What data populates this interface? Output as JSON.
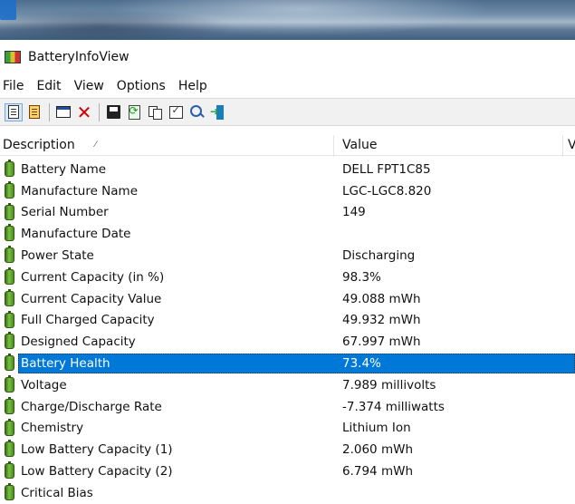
{
  "window": {
    "title": "BatteryInfoView"
  },
  "menu": [
    "File",
    "Edit",
    "View",
    "Options",
    "Help"
  ],
  "columns": {
    "description": "Description",
    "value": "Value",
    "extra": "V"
  },
  "rows": [
    {
      "description": "Battery Name",
      "value": "DELL FPT1C85"
    },
    {
      "description": "Manufacture Name",
      "value": "LGC-LGC8.820"
    },
    {
      "description": "Serial Number",
      "value": "149"
    },
    {
      "description": "Manufacture Date",
      "value": ""
    },
    {
      "description": "Power State",
      "value": "Discharging"
    },
    {
      "description": "Current Capacity (in %)",
      "value": "98.3%"
    },
    {
      "description": "Current Capacity Value",
      "value": "49.088 mWh"
    },
    {
      "description": "Full Charged Capacity",
      "value": "49.932 mWh"
    },
    {
      "description": "Designed Capacity",
      "value": "67.997 mWh"
    },
    {
      "description": "Battery Health",
      "value": "73.4%",
      "selected": true
    },
    {
      "description": "Voltage",
      "value": "7.989 millivolts"
    },
    {
      "description": "Charge/Discharge Rate",
      "value": "-7.374 milliwatts"
    },
    {
      "description": "Chemistry",
      "value": "Lithium Ion"
    },
    {
      "description": "Low Battery Capacity (1)",
      "value": "2.060 mWh"
    },
    {
      "description": "Low Battery Capacity (2)",
      "value": "6.794 mWh"
    },
    {
      "description": "Critical Bias",
      "value": ""
    }
  ],
  "colors": {
    "selection": "#0078d7",
    "battery_icon": "#79c043"
  }
}
